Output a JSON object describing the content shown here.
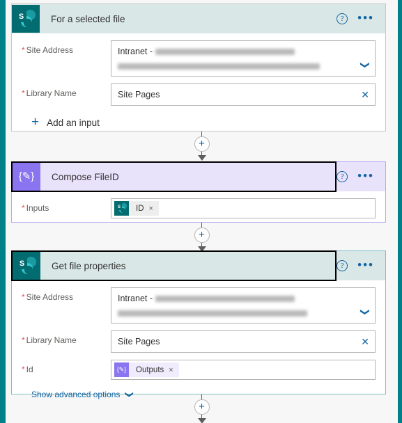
{
  "theme": {
    "frame_color": "#00818a",
    "canvas_bg": "#f7f7f7",
    "sharepoint_teal": "#036c70",
    "sharepoint_header": "#d9e7e7",
    "compose_purple": "#8b74ef",
    "compose_header": "#e9e2fb",
    "link_blue": "#1264a3",
    "required_red": "#e8505b"
  },
  "cards": [
    {
      "id": "for-a-selected-file",
      "title": "For a selected file",
      "connector_type": "sharepoint",
      "icon": "sharepoint-icon",
      "icon_letter": "S",
      "selected": false,
      "help_label": "?",
      "more_label": "•••",
      "fields": [
        {
          "name": "site-address",
          "label": "Site Address",
          "required_marker": "*",
          "type": "combobox",
          "value_prefix": "Intranet -",
          "value_redacted": true,
          "affix_icon": "chevron-down-icon"
        },
        {
          "name": "library-name",
          "label": "Library Name",
          "required_marker": "*",
          "type": "combobox",
          "value": "Site Pages",
          "affix_icon": "clear-x-icon"
        }
      ],
      "add_input_label": "Add an input",
      "add_input_plus": "+"
    },
    {
      "id": "compose-fileid",
      "title": "Compose FileID",
      "connector_type": "compose",
      "icon": "compose-icon",
      "icon_glyph": "{✎}",
      "selected": true,
      "help_label": "?",
      "more_label": "•••",
      "fields": [
        {
          "name": "inputs",
          "label": "Inputs",
          "required_marker": "*",
          "type": "token",
          "token": {
            "label": "ID",
            "icon": "sharepoint-icon",
            "icon_letter": "S",
            "remove_label": "×"
          }
        }
      ]
    },
    {
      "id": "get-file-properties",
      "title": "Get file properties",
      "connector_type": "sharepoint",
      "icon": "sharepoint-icon",
      "icon_letter": "S",
      "selected": true,
      "help_label": "?",
      "more_label": "•••",
      "fields": [
        {
          "name": "site-address",
          "label": "Site Address",
          "required_marker": "*",
          "type": "combobox",
          "value_prefix": "Intranet -",
          "value_redacted": true,
          "affix_icon": "chevron-down-icon"
        },
        {
          "name": "library-name",
          "label": "Library Name",
          "required_marker": "*",
          "type": "combobox",
          "value": "Site Pages",
          "affix_icon": "clear-x-icon"
        },
        {
          "name": "id",
          "label": "Id",
          "required_marker": "*",
          "type": "token",
          "token": {
            "label": "Outputs",
            "icon": "compose-icon",
            "icon_glyph": "{✎}",
            "remove_label": "×"
          }
        }
      ],
      "advanced_label": "Show advanced options",
      "advanced_chevron": "⌄"
    }
  ],
  "connectors": [
    {
      "name": "connector-1",
      "plus_label": "+"
    },
    {
      "name": "connector-2",
      "plus_label": "+"
    },
    {
      "name": "connector-3",
      "plus_label": "+"
    }
  ]
}
